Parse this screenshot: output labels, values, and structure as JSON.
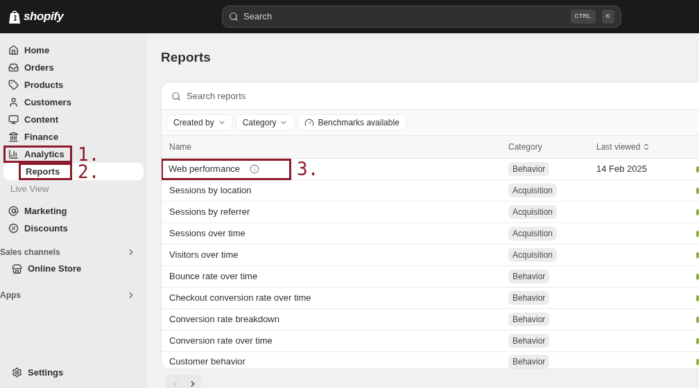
{
  "topbar": {
    "logo_text": "shopify",
    "search": {
      "placeholder": "Search",
      "shortcut_keys": [
        "CTRL",
        "K"
      ]
    }
  },
  "sidebar": {
    "items": [
      {
        "label": "Home",
        "selected": false
      },
      {
        "label": "Orders",
        "selected": false
      },
      {
        "label": "Products",
        "selected": false
      },
      {
        "label": "Customers",
        "selected": false
      },
      {
        "label": "Content",
        "selected": false
      },
      {
        "label": "Finance",
        "selected": false
      },
      {
        "label": "Analytics",
        "selected": false,
        "annotation": "1.",
        "children": [
          {
            "label": "Reports",
            "selected": true,
            "annotation": "2."
          },
          {
            "label": "Live View",
            "selected": false
          }
        ]
      },
      {
        "label": "Marketing",
        "selected": false
      },
      {
        "label": "Discounts",
        "selected": false
      }
    ],
    "sections": [
      {
        "title": "Sales channels",
        "items": [
          {
            "label": "Online Store",
            "selected": false
          }
        ]
      },
      {
        "title": "Apps"
      }
    ],
    "footer": {
      "label": "Settings"
    }
  },
  "page": {
    "title": "Reports",
    "search": {
      "placeholder": "Search reports"
    },
    "filters": [
      {
        "label": "Created by",
        "kind": "dropdown"
      },
      {
        "label": "Category",
        "kind": "dropdown"
      },
      {
        "label": "Benchmarks available",
        "kind": "toggle"
      }
    ],
    "table": {
      "columns": [
        {
          "label": "Name",
          "sortable": false
        },
        {
          "label": "Category",
          "sortable": false
        },
        {
          "label": "Last viewed",
          "sortable": true
        }
      ],
      "rows": [
        {
          "name": "Web performance",
          "info": true,
          "category": "Behavior",
          "last_viewed": "14 Feb 2025",
          "annotation": "3."
        },
        {
          "name": "Sessions by location",
          "info": false,
          "category": "Acquisition"
        },
        {
          "name": "Sessions by referrer",
          "info": false,
          "category": "Acquisition"
        },
        {
          "name": "Sessions over time",
          "info": false,
          "category": "Acquisition"
        },
        {
          "name": "Visitors over time",
          "info": false,
          "category": "Acquisition"
        },
        {
          "name": "Bounce rate over time",
          "info": false,
          "category": "Behavior"
        },
        {
          "name": "Checkout conversion rate over time",
          "info": false,
          "category": "Behavior"
        },
        {
          "name": "Conversion rate breakdown",
          "info": false,
          "category": "Behavior"
        },
        {
          "name": "Conversion rate over time",
          "info": false,
          "category": "Behavior"
        },
        {
          "name": "Customer behavior",
          "info": false,
          "category": "Behavior"
        }
      ]
    },
    "pagination": {
      "previous_disabled": true,
      "next_disabled": false
    }
  }
}
